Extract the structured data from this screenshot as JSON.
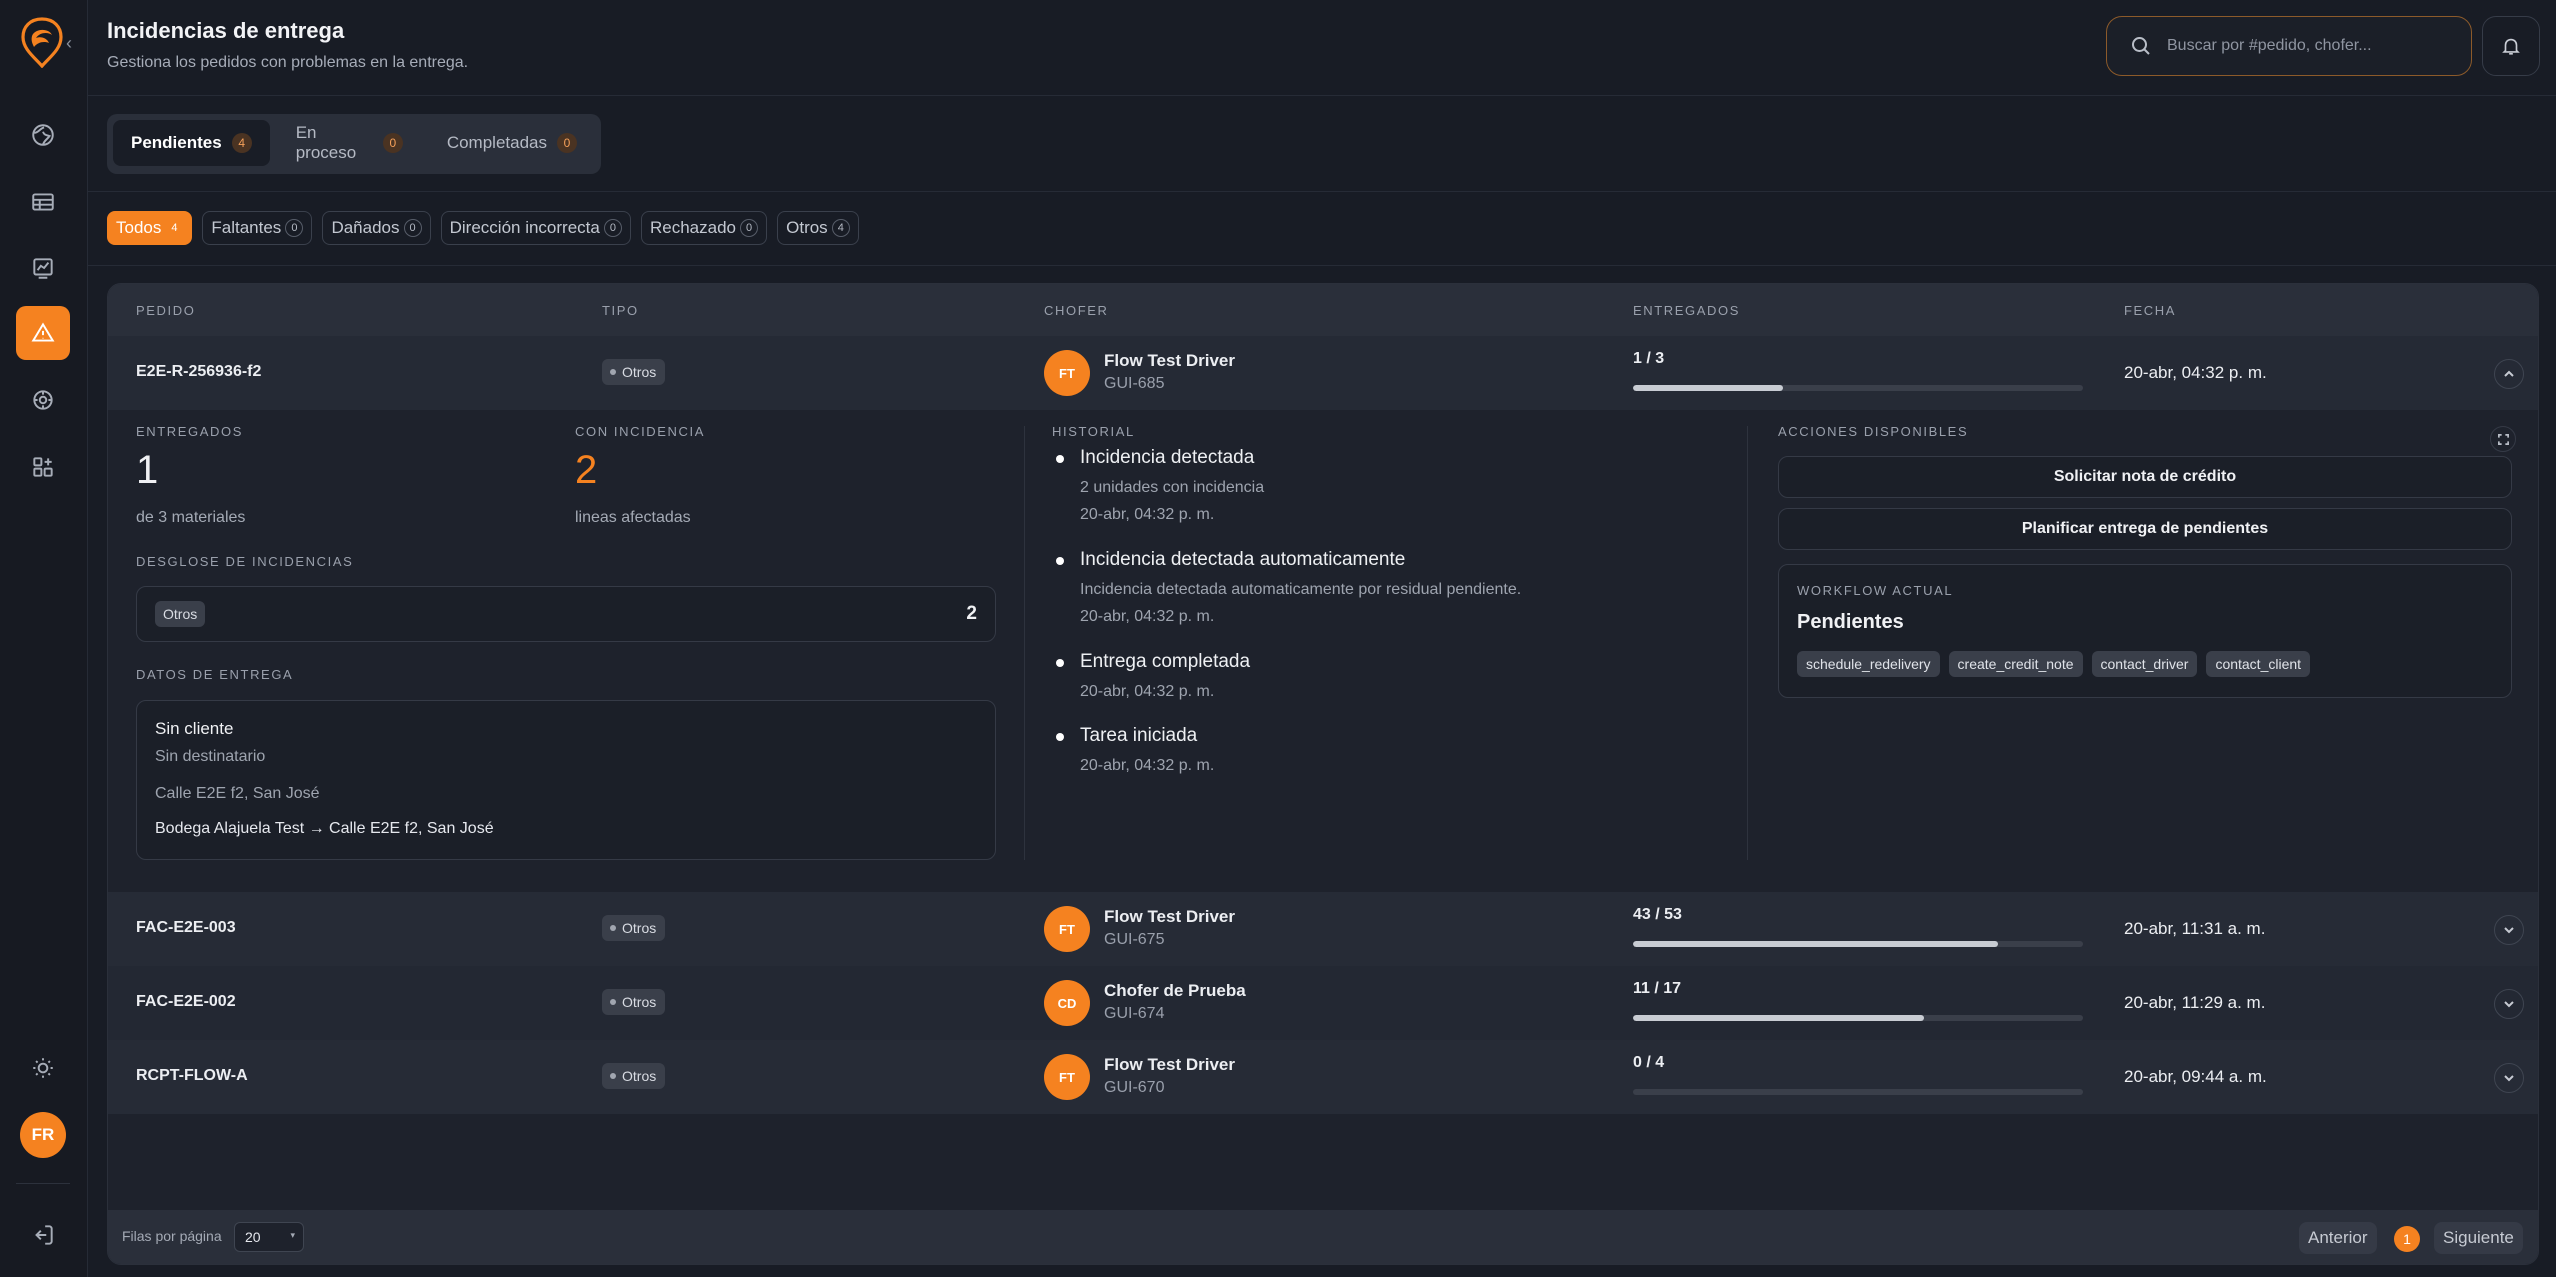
{
  "header": {
    "title": "Incidencias de entrega",
    "subtitle": "Gestiona los pedidos con problemas en la entrega.",
    "search_placeholder": "Buscar por #pedido, chofer..."
  },
  "user": {
    "initials": "FR"
  },
  "tabs": [
    {
      "label": "Pendientes",
      "count": "4",
      "active": true
    },
    {
      "label": "En proceso",
      "count": "0"
    },
    {
      "label": "Completadas",
      "count": "0"
    }
  ],
  "filters": [
    {
      "label": "Todos",
      "count": "4",
      "active": true
    },
    {
      "label": "Faltantes",
      "count": "0"
    },
    {
      "label": "Dañados",
      "count": "0"
    },
    {
      "label": "Dirección incorrecta",
      "count": "0"
    },
    {
      "label": "Rechazado",
      "count": "0"
    },
    {
      "label": "Otros",
      "count": "4"
    }
  ],
  "table": {
    "columns": [
      "PEDIDO",
      "TIPO",
      "CHOFER",
      "ENTREGADOS",
      "FECHA"
    ],
    "rows": [
      {
        "pedido": "E2E-R-256936-f2",
        "tipo": "Otros",
        "initials": "FT",
        "driver": "Flow Test Driver",
        "code": "GUI-685",
        "delivered": "1 / 3",
        "progress": 0.333,
        "fecha": "20-abr, 04:32 p. m."
      },
      {
        "pedido": "FAC-E2E-003",
        "tipo": "Otros",
        "initials": "FT",
        "driver": "Flow Test Driver",
        "code": "GUI-675",
        "delivered": "43 / 53",
        "progress": 0.811,
        "fecha": "20-abr, 11:31 a. m."
      },
      {
        "pedido": "FAC-E2E-002",
        "tipo": "Otros",
        "initials": "CD",
        "driver": "Chofer de Prueba",
        "code": "GUI-674",
        "delivered": "11 / 17",
        "progress": 0.647,
        "fecha": "20-abr, 11:29 a. m."
      },
      {
        "pedido": "RCPT-FLOW-A",
        "tipo": "Otros",
        "initials": "FT",
        "driver": "Flow Test Driver",
        "code": "GUI-670",
        "delivered": "0 / 4",
        "progress": 0,
        "fecha": "20-abr, 09:44 a. m."
      }
    ]
  },
  "detail": {
    "delivered_label": "ENTREGADOS",
    "delivered_value": "1",
    "delivered_sub": "de 3 materiales",
    "incident_label": "CON INCIDENCIA",
    "incident_value": "2",
    "incident_sub": "lineas afectadas",
    "breakdown_label": "DESGLOSE DE INCIDENCIAS",
    "breakdown_type": "Otros",
    "breakdown_count": "2",
    "delivery_label": "DATOS DE ENTREGA",
    "client": "Sin cliente",
    "recipient": "Sin destinatario",
    "address": "Calle E2E f2, San José",
    "route": "Bodega Alajuela Test → Calle E2E f2, San José",
    "history_label": "HISTORIAL",
    "history": [
      {
        "title": "Incidencia detectada",
        "sub": "2 unidades con incidencia",
        "time": "20-abr, 04:32 p. m."
      },
      {
        "title": "Incidencia detectada automaticamente",
        "sub": "Incidencia detectada automaticamente por residual pendiente.",
        "time": "20-abr, 04:32 p. m."
      },
      {
        "title": "Entrega completada",
        "time": "20-abr, 04:32 p. m."
      },
      {
        "title": "Tarea iniciada",
        "time": "20-abr, 04:32 p. m."
      }
    ],
    "actions_label": "ACCIONES DISPONIBLES",
    "action_credit": "Solicitar nota de crédito",
    "action_plan": "Planificar entrega de pendientes",
    "workflow_label": "WORKFLOW ACTUAL",
    "workflow_state": "Pendientes",
    "workflow_tags": [
      "schedule_redelivery",
      "create_credit_note",
      "contact_driver",
      "contact_client"
    ]
  },
  "footer": {
    "rows_per_page_label": "Filas por página",
    "rows_per_page": "20",
    "prev": "Anterior",
    "page": "1",
    "next": "Siguiente"
  },
  "colors": {
    "accent": "#f58220",
    "background": "#181c25"
  }
}
